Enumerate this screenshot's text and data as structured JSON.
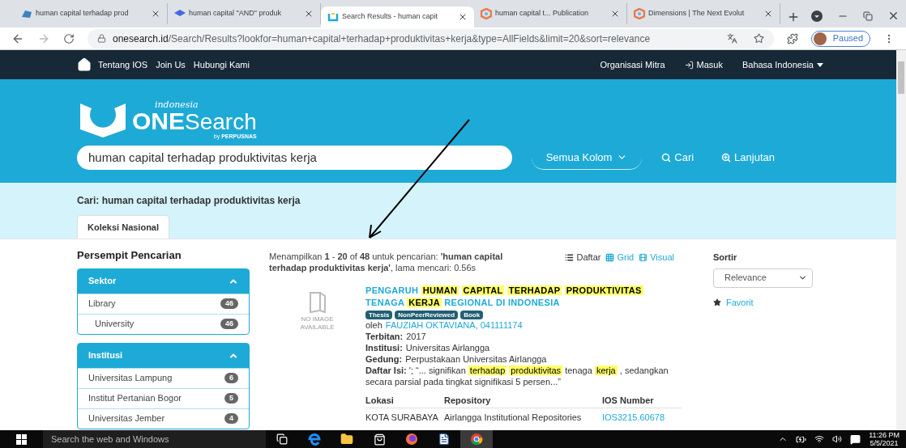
{
  "browser": {
    "tabs": [
      {
        "title": "human capital terhadap prod",
        "kind": "cloud",
        "selected": false
      },
      {
        "title": "human capital \"AND\" produk",
        "kind": "cap",
        "selected": false
      },
      {
        "title": "Search Results - human capit",
        "kind": "onesearch",
        "selected": true
      },
      {
        "title": "human capital t... Publication",
        "kind": "dimensions",
        "selected": false
      },
      {
        "title": "Dimensions | The Next Evolut",
        "kind": "dimensions",
        "selected": false
      }
    ],
    "url_host": "onesearch.id",
    "url_path": "/Search/Results?lookfor=human+capital+terhadap+produktivitas+kerja&type=AllFields&limit=20&sort=relevance",
    "profile_label": "Paused"
  },
  "navbar": {
    "left": [
      "Tentang IOS",
      "Join Us",
      "Hubungi Kami"
    ],
    "right": [
      {
        "label": "Organisasi Mitra",
        "kind": "plain"
      },
      {
        "label": "Masuk",
        "kind": "login"
      },
      {
        "label": "Bahasa Indonesia",
        "kind": "dropdown"
      }
    ]
  },
  "logo": {
    "small": "indonesia",
    "one": "ONE",
    "search": "Search",
    "by": "by",
    "perpusnas": "PERPUSNAS"
  },
  "search": {
    "value": "human capital terhadap produktivitas kerja",
    "scope": "Semua Kolom",
    "submit": "Cari",
    "advanced": "Lanjutan"
  },
  "query_heading": "Cari: human capital terhadap produktivitas kerja",
  "collection_tabs": [
    {
      "label": "Koleksi Nasional",
      "selected": true
    }
  ],
  "sidebar": {
    "title": "Persempit Pencarian",
    "facets": [
      {
        "name": "Sektor",
        "expanded": true,
        "items": [
          {
            "label": "Library",
            "count": "46",
            "children": [
              {
                "label": "University",
                "count": "46"
              }
            ]
          }
        ]
      },
      {
        "name": "Institusi",
        "expanded": true,
        "items": [
          {
            "label": "Universitas Lampung",
            "count": "6"
          },
          {
            "label": "Institut Pertanian Bogor",
            "count": "5"
          },
          {
            "label": "Universitas Jember",
            "count": "4"
          }
        ]
      }
    ]
  },
  "summary": "Menampilkan **1** - **20** of **48** untuk pencarian: **'human capital terhadap produktivitas kerja'**, lama mencari: 0.56s",
  "views": [
    {
      "label": "Daftar",
      "selected": true,
      "kind": "list"
    },
    {
      "label": "Grid",
      "selected": false,
      "kind": "grid"
    },
    {
      "label": "Visual",
      "selected": false,
      "kind": "visual"
    }
  ],
  "result": {
    "no_image": "NO IMAGE AVAILABLE",
    "title": [
      {
        "text": "PENGARUH",
        "highlight": false
      },
      {
        "text": "HUMAN",
        "highlight": true
      },
      {
        "text": "CAPITAL",
        "highlight": true
      },
      {
        "text": "TERHADAP",
        "highlight": true
      },
      {
        "text": "PRODUKTIVITAS",
        "highlight": true
      },
      {
        "text": "TENAGA",
        "highlight": false
      },
      {
        "text": "KERJA",
        "highlight": true
      },
      {
        "text": "REGIONAL DI INDONESIA",
        "highlight": false
      }
    ],
    "tags": [
      "Thesis",
      "NonPeerReviewed",
      "Book"
    ],
    "by_label": "oleh",
    "author": "FAUZIAH OKTAVIANA, 041111174",
    "fields": [
      {
        "label": "Terbitan:",
        "value": "2017"
      },
      {
        "label": "Institusi:",
        "value": "Universitas Airlangga"
      },
      {
        "label": "Gedung:",
        "value": "Perpustakaan Universitas Airlangga"
      }
    ],
    "contents_label": "Daftar Isi:",
    "contents": [
      {
        "text": "'; “... signifikan",
        "highlight": false
      },
      {
        "text": "terhadap",
        "highlight": true
      },
      {
        "text": "produktivitas",
        "highlight": true
      },
      {
        "text": "tenaga",
        "highlight": false
      },
      {
        "text": "kerja",
        "highlight": true
      },
      {
        "text": ", sedangkan secara parsial pada tingkat signifikasi 5 persen...”",
        "highlight": false
      }
    ],
    "holdings": {
      "columns": [
        "Lokasi",
        "Repository",
        "IOS Number"
      ],
      "rows": [
        [
          "KOTA SURABAYA",
          "Airlangga Institutional Repositories",
          "IOS3215.60678"
        ]
      ]
    }
  },
  "sort": {
    "label": "Sortir",
    "value": "Relevance",
    "favorite": "Favorit"
  },
  "taskbar": {
    "search_placeholder": "Search the web and Windows",
    "apps": [
      {
        "kind": "taskview",
        "selected": false
      },
      {
        "kind": "edge",
        "selected": false
      },
      {
        "kind": "folder",
        "selected": false
      },
      {
        "kind": "store",
        "selected": false
      },
      {
        "kind": "firefox",
        "selected": false
      },
      {
        "kind": "word",
        "selected": false
      },
      {
        "kind": "chrome",
        "selected": true
      }
    ],
    "time": "11:26 PM",
    "date": "5/5/2021"
  }
}
